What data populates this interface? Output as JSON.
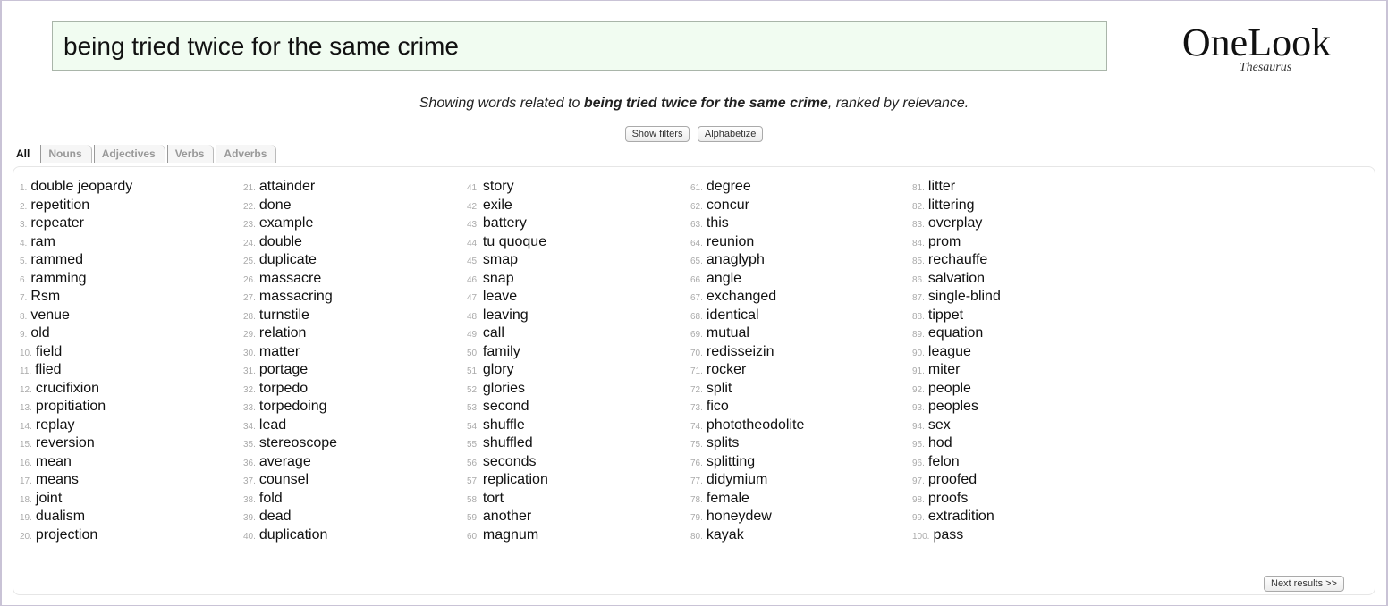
{
  "search": {
    "value": "being tried twice for the same crime"
  },
  "logo": {
    "main": "OneLook",
    "sub": "Thesaurus"
  },
  "summary": {
    "prefix": "Showing words related to ",
    "query": "being tried twice for the same crime",
    "suffix": ", ranked by relevance."
  },
  "buttons": {
    "show_filters": "Show filters",
    "alphabetize": "Alphabetize",
    "next": "Next results >>"
  },
  "tabs": [
    {
      "label": "All",
      "active": true
    },
    {
      "label": "Nouns"
    },
    {
      "label": "Adjectives"
    },
    {
      "label": "Verbs"
    },
    {
      "label": "Adverbs"
    }
  ],
  "results": [
    "double jeopardy",
    "repetition",
    "repeater",
    "ram",
    "rammed",
    "ramming",
    "Rsm",
    "venue",
    "old",
    "field",
    "flied",
    "crucifixion",
    "propitiation",
    "replay",
    "reversion",
    "mean",
    "means",
    "joint",
    "dualism",
    "projection",
    "attainder",
    "done",
    "example",
    "double",
    "duplicate",
    "massacre",
    "massacring",
    "turnstile",
    "relation",
    "matter",
    "portage",
    "torpedo",
    "torpedoing",
    "lead",
    "stereoscope",
    "average",
    "counsel",
    "fold",
    "dead",
    "duplication",
    "story",
    "exile",
    "battery",
    "tu quoque",
    "smap",
    "snap",
    "leave",
    "leaving",
    "call",
    "family",
    "glory",
    "glories",
    "second",
    "shuffle",
    "shuffled",
    "seconds",
    "replication",
    "tort",
    "another",
    "magnum",
    "degree",
    "concur",
    "this",
    "reunion",
    "anaglyph",
    "angle",
    "exchanged",
    "identical",
    "mutual",
    "redisseizin",
    "rocker",
    "split",
    "fico",
    "phototheodolite",
    "splits",
    "splitting",
    "didymium",
    "female",
    "honeydew",
    "kayak",
    "litter",
    "littering",
    "overplay",
    "prom",
    "rechauffe",
    "salvation",
    "single-blind",
    "tippet",
    "equation",
    "league",
    "miter",
    "people",
    "peoples",
    "sex",
    "hod",
    "felon",
    "proofed",
    "proofs",
    "extradition",
    "pass"
  ]
}
